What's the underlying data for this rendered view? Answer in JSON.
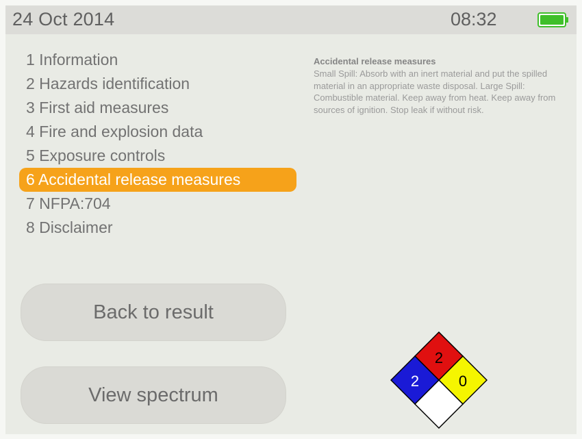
{
  "status_bar": {
    "date": "24 Oct 2014",
    "time": "08:32",
    "battery_icon": "battery-full-icon",
    "battery_color": "#3fbf2a"
  },
  "menu": {
    "items": [
      {
        "label": "1 Information"
      },
      {
        "label": "2 Hazards identification"
      },
      {
        "label": "3 First aid measures"
      },
      {
        "label": "4 Fire and explosion data"
      },
      {
        "label": "5 Exposure controls"
      },
      {
        "label": "6 Accidental release measures"
      },
      {
        "label": "7 NFPA:704"
      },
      {
        "label": "8 Disclaimer"
      }
    ],
    "selected_index": 5,
    "selected_color": "#f6a21a"
  },
  "detail": {
    "title": "Accidental release measures",
    "body": "Small Spill: Absorb with an inert material and put the spilled material in an appropriate waste disposal. Large Spill: Combustible material. Keep away from heat. Keep away from sources of ignition. Stop leak if without risk."
  },
  "buttons": {
    "back": "Back to result",
    "spectrum": "View spectrum"
  },
  "nfpa": {
    "health": "2",
    "flammability": "2",
    "instability": "0",
    "special": "",
    "colors": {
      "health": "#1a1ad6",
      "flammability": "#e01010",
      "instability": "#f5f500",
      "special": "#ffffff"
    }
  }
}
